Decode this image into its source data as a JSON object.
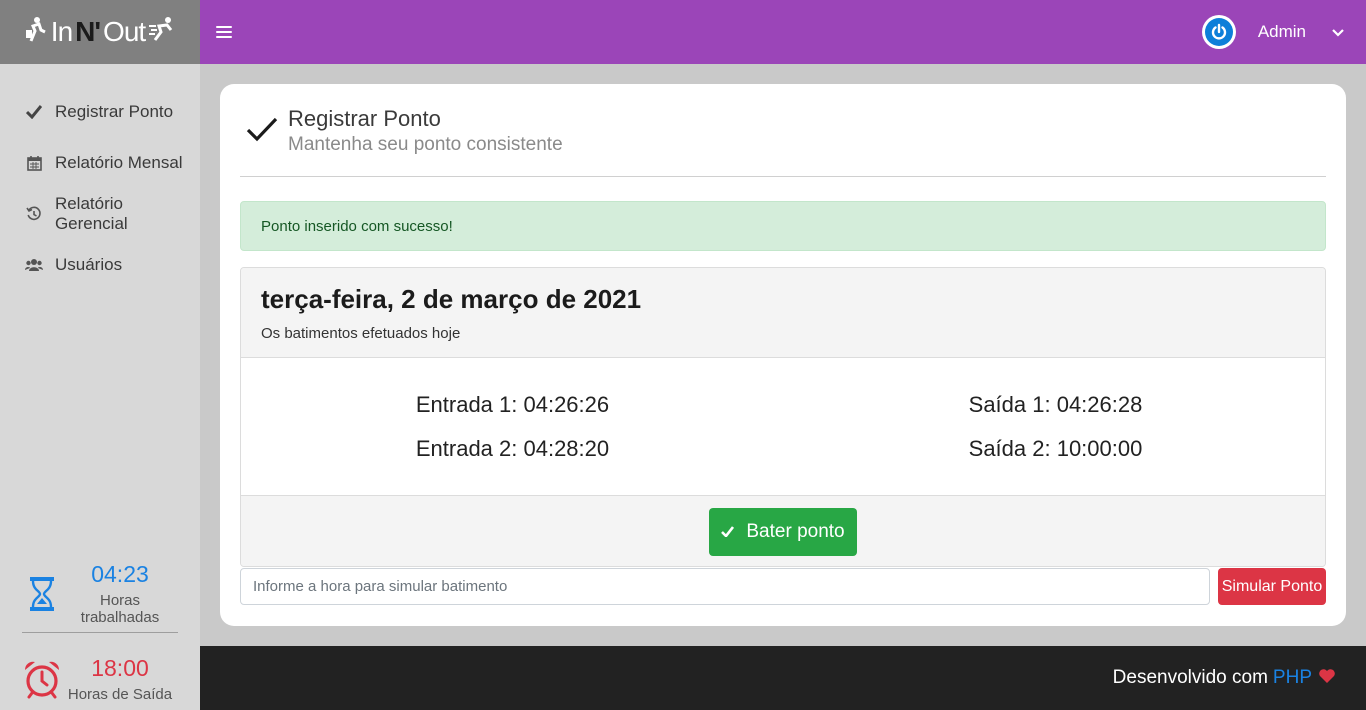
{
  "brand": {
    "part1": "In",
    "part2": "N'",
    "part3": "Out"
  },
  "header": {
    "user_name": "Admin"
  },
  "sidebar": {
    "items": [
      {
        "label": "Registrar Ponto",
        "icon": "check-icon"
      },
      {
        "label": "Relatório Mensal",
        "icon": "calendar-icon"
      },
      {
        "label": "Relatório Gerencial",
        "icon": "history-icon"
      },
      {
        "label": "Usuários",
        "icon": "users-icon"
      }
    ],
    "worked": {
      "value": "04:23",
      "label": "Horas trabalhadas"
    },
    "exit": {
      "value": "18:00",
      "label": "Horas de Saída"
    }
  },
  "page": {
    "title": "Registrar Ponto",
    "subtitle": "Mantenha seu ponto consistente"
  },
  "alert": {
    "text": "Ponto inserido com sucesso!"
  },
  "day": {
    "title": "terça-feira, 2 de março de 2021",
    "subtitle": "Os batimentos efetuados hoje",
    "entries": [
      "Entrada 1: 04:26:26",
      "Entrada 2: 04:28:20"
    ],
    "exits": [
      "Saída 1: 04:26:28",
      "Saída 2: 10:00:00"
    ]
  },
  "actions": {
    "punch_label": "Bater ponto",
    "simulate_placeholder": "Informe a hora para simular batimento",
    "simulate_label": "Simular Ponto"
  },
  "footer": {
    "text": "Desenvolvido com",
    "tech": "PHP"
  },
  "colors": {
    "topbar": "#9b45b8",
    "success": "#28a745",
    "danger": "#dc3545",
    "info": "#1a82e2"
  }
}
